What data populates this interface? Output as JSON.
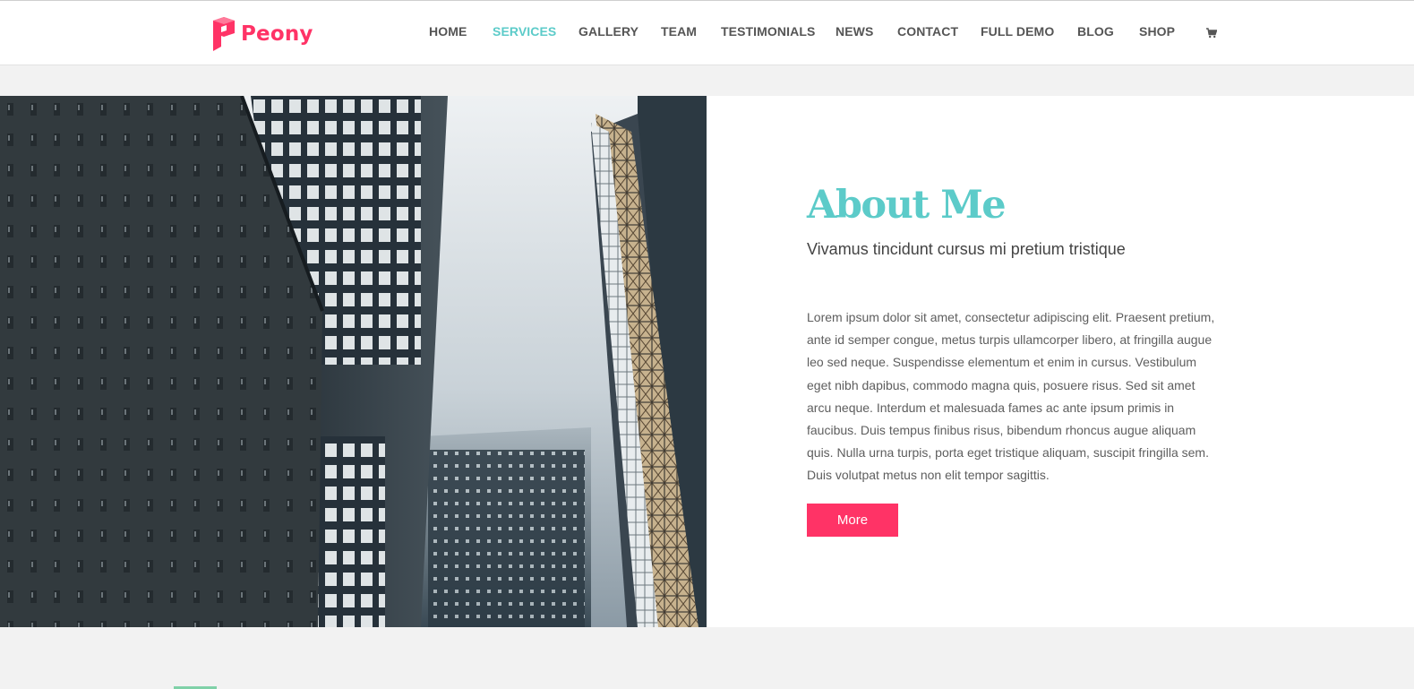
{
  "brand": {
    "name": "Peony",
    "color": "#ff3366"
  },
  "nav": {
    "items": [
      {
        "label": "HOME",
        "active": false
      },
      {
        "label": "SERVICES",
        "active": true
      },
      {
        "label": "GALLERY",
        "active": false
      },
      {
        "label": "TEAM",
        "active": false
      },
      {
        "label": "TESTIMONIALS",
        "active": false
      },
      {
        "label": "NEWS",
        "active": false
      },
      {
        "label": "CONTACT",
        "active": false
      },
      {
        "label": "FULL DEMO",
        "active": false
      },
      {
        "label": "BLOG",
        "active": false
      },
      {
        "label": "SHOP",
        "active": false
      }
    ],
    "cart_icon": "shopping-cart-icon",
    "active_color": "#5ccbc9"
  },
  "about": {
    "title": "About Me",
    "subtitle": "Vivamus tincidunt cursus mi pretium tristique",
    "body": "Lorem ipsum dolor sit amet, consectetur adipiscing elit. Praesent pretium, ante id semper congue, metus turpis ullamcorper libero, at fringilla augue leo sed neque. Suspendisse elementum et enim in cursus. Vestibulum eget nibh dapibus, commodo magna quis, posuere risus. Sed sit amet arcu neque. Interdum et malesuada fames ac ante ipsum primis in faucibus. Duis tempus finibus risus, bibendum rhoncus augue aliquam quis. Nulla urna turpis, porta eget tristique aliquam, suscipit fringilla sem. Duis volutpat metus non elit tempor sagittis.",
    "button_label": "More",
    "title_color": "#5ccbc9",
    "button_color": "#ff3366",
    "image": "skyscrapers-photo"
  }
}
